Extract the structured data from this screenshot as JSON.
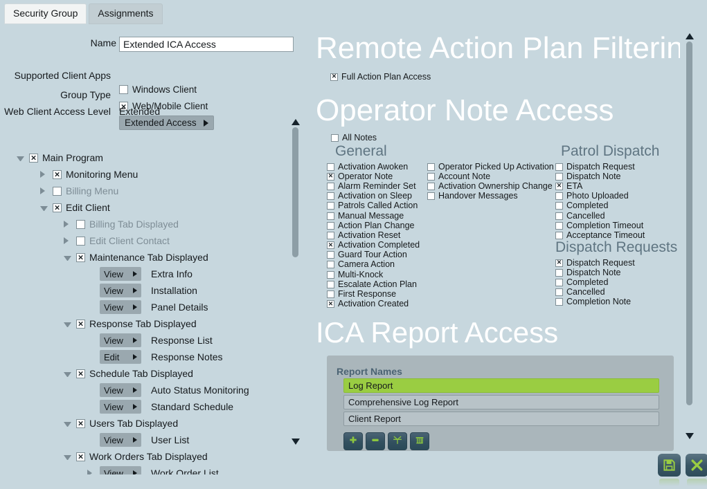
{
  "tabs": [
    {
      "label": "Security Group",
      "active": true
    },
    {
      "label": "Assignments",
      "active": false
    }
  ],
  "form": {
    "name_label": "Name",
    "name_value": "Extended ICA Access",
    "name_placeholder": "",
    "supported_client_apps_label": "Supported Client Apps",
    "windows_client_label": "Windows Client",
    "windows_client_checked": false,
    "web_mobile_client_label": "Web/Mobile Client",
    "web_mobile_client_checked": true,
    "group_type_label": "Group Type",
    "group_type_value": "Extended Access",
    "web_client_access_level_label": "Web Client Access Level",
    "web_client_access_level_value": "Extended"
  },
  "tree": [
    {
      "indent": 0,
      "twisty": "down",
      "checkbox": true,
      "checked": true,
      "label": "Main Program",
      "dim": false
    },
    {
      "indent": 1,
      "twisty": "right",
      "checkbox": true,
      "checked": true,
      "label": "Monitoring Menu",
      "dim": false
    },
    {
      "indent": 1,
      "twisty": "right",
      "checkbox": true,
      "checked": false,
      "label": "Billing Menu",
      "dim": true
    },
    {
      "indent": 1,
      "twisty": "down",
      "checkbox": true,
      "checked": true,
      "label": "Edit Client",
      "dim": false
    },
    {
      "indent": 2,
      "twisty": "right",
      "checkbox": true,
      "checked": false,
      "label": "Billing Tab Displayed",
      "dim": true
    },
    {
      "indent": 2,
      "twisty": "right",
      "checkbox": true,
      "checked": false,
      "label": "Edit Client Contact",
      "dim": true
    },
    {
      "indent": 2,
      "twisty": "down",
      "checkbox": true,
      "checked": true,
      "label": "Maintenance Tab Displayed",
      "dim": false
    },
    {
      "indent": 3,
      "twisty": "none",
      "perm": "View",
      "label": "Extra Info",
      "dim": false
    },
    {
      "indent": 3,
      "twisty": "none",
      "perm": "View",
      "label": "Installation",
      "dim": false
    },
    {
      "indent": 3,
      "twisty": "none",
      "perm": "View",
      "label": "Panel Details",
      "dim": false
    },
    {
      "indent": 2,
      "twisty": "down",
      "checkbox": true,
      "checked": true,
      "label": "Response Tab Displayed",
      "dim": false
    },
    {
      "indent": 3,
      "twisty": "none",
      "perm": "View",
      "label": "Response List",
      "dim": false
    },
    {
      "indent": 3,
      "twisty": "none",
      "perm": "Edit",
      "label": "Response Notes",
      "dim": false
    },
    {
      "indent": 2,
      "twisty": "down",
      "checkbox": true,
      "checked": true,
      "label": "Schedule Tab Displayed",
      "dim": false
    },
    {
      "indent": 3,
      "twisty": "none",
      "perm": "View",
      "label": "Auto Status Monitoring",
      "dim": false
    },
    {
      "indent": 3,
      "twisty": "none",
      "perm": "View",
      "label": "Standard Schedule",
      "dim": false
    },
    {
      "indent": 2,
      "twisty": "down",
      "checkbox": true,
      "checked": true,
      "label": "Users Tab Displayed",
      "dim": false
    },
    {
      "indent": 3,
      "twisty": "none",
      "perm": "View",
      "label": "User List",
      "dim": false
    },
    {
      "indent": 2,
      "twisty": "down",
      "checkbox": true,
      "checked": true,
      "label": "Work Orders Tab Displayed",
      "dim": false
    },
    {
      "indent": 3,
      "twisty": "right",
      "perm": "View",
      "label": "Work Order List",
      "dim": false
    }
  ],
  "right": {
    "remote_action_plan_heading": "Remote Action Plan Filtering",
    "full_action_plan_access_label": "Full Action Plan Access",
    "full_action_plan_access_checked": true,
    "operator_note_heading": "Operator Note Access",
    "all_notes_label": "All Notes",
    "all_notes_checked": false,
    "general_heading": "General",
    "general_items": [
      {
        "label": "Activation Awoken",
        "checked": false
      },
      {
        "label": "Operator Note",
        "checked": true
      },
      {
        "label": "Alarm Reminder Set",
        "checked": false
      },
      {
        "label": "Activation on Sleep",
        "checked": false
      },
      {
        "label": "Patrols Called Action",
        "checked": false
      },
      {
        "label": "Manual Message",
        "checked": false
      },
      {
        "label": "Action Plan Change",
        "checked": false
      },
      {
        "label": "Activation Reset",
        "checked": false
      },
      {
        "label": "Activation Completed",
        "checked": true
      },
      {
        "label": "Guard Tour Action",
        "checked": false
      },
      {
        "label": "Camera Action",
        "checked": false
      },
      {
        "label": "Multi-Knock",
        "checked": false
      },
      {
        "label": "Escalate Action Plan",
        "checked": false
      },
      {
        "label": "First Response",
        "checked": false
      },
      {
        "label": "Activation Created",
        "checked": true
      }
    ],
    "general_items_col2": [
      {
        "label": "Operator Picked Up Activation",
        "checked": false
      },
      {
        "label": "Account Note",
        "checked": false
      },
      {
        "label": "Activation Ownership Change",
        "checked": false
      },
      {
        "label": "Handover Messages",
        "checked": false
      }
    ],
    "patrol_dispatch_heading": "Patrol Dispatch",
    "patrol_dispatch_items": [
      {
        "label": "Dispatch Request",
        "checked": false
      },
      {
        "label": "Dispatch Note",
        "checked": false
      },
      {
        "label": "ETA",
        "checked": true
      },
      {
        "label": "Photo Uploaded",
        "checked": false
      },
      {
        "label": "Completed",
        "checked": false
      },
      {
        "label": "Cancelled",
        "checked": false
      },
      {
        "label": "Completion Timeout",
        "checked": false
      },
      {
        "label": "Acceptance Timeout",
        "checked": false
      }
    ],
    "dispatch_requests_heading": "Dispatch Requests",
    "dispatch_requests_items": [
      {
        "label": "Dispatch Request",
        "checked": true
      },
      {
        "label": "Dispatch Note",
        "checked": false
      },
      {
        "label": "Completed",
        "checked": false
      },
      {
        "label": "Cancelled",
        "checked": false
      },
      {
        "label": "Completion Note",
        "checked": false
      }
    ],
    "ica_report_heading": "ICA Report Access",
    "report_names_label": "Report Names",
    "reports": [
      {
        "label": "Log Report",
        "selected": true
      },
      {
        "label": "Comprehensive Log Report",
        "selected": false
      },
      {
        "label": "Client Report",
        "selected": false
      }
    ],
    "report_tools": [
      {
        "icon": "plus-icon",
        "name": "add-report-button"
      },
      {
        "icon": "minus-icon",
        "name": "remove-report-button"
      },
      {
        "icon": "burst-icon",
        "name": "reset-report-button"
      },
      {
        "icon": "trash-icon",
        "name": "delete-report-button"
      }
    ]
  },
  "footer": {
    "save_icon": "save-icon",
    "close_icon": "close-icon"
  },
  "colors": {
    "background": "#c7d7de",
    "accent_green": "#9acd42",
    "heading_white": "#ffffff",
    "subheading_blue": "#5f7582",
    "panel_gray": "#aab6bb",
    "button_gray": "#9aa8af"
  }
}
